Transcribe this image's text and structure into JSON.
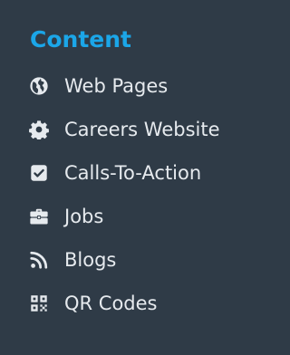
{
  "section": {
    "title": "Content"
  },
  "menu": {
    "items": [
      {
        "label": "Web Pages",
        "icon": "globe-icon"
      },
      {
        "label": "Careers Website",
        "icon": "gear-icon"
      },
      {
        "label": "Calls-To-Action",
        "icon": "checkbox-icon"
      },
      {
        "label": "Jobs",
        "icon": "briefcase-icon"
      },
      {
        "label": "Blogs",
        "icon": "rss-icon"
      },
      {
        "label": "QR Codes",
        "icon": "qr-code-icon"
      }
    ]
  },
  "colors": {
    "background": "#2f3b47",
    "heading": "#1ba6e8",
    "text": "#e6eaee"
  }
}
